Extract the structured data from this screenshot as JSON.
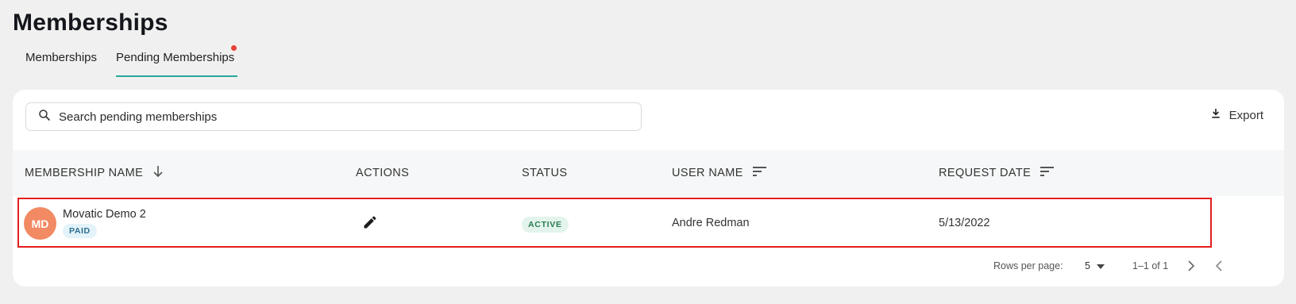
{
  "page": {
    "title": "Memberships"
  },
  "tabs": [
    {
      "label": "Memberships",
      "active": false
    },
    {
      "label": "Pending Memberships",
      "active": true
    }
  ],
  "search": {
    "placeholder": "Search pending memberships",
    "value": ""
  },
  "toolbar": {
    "export_label": "Export"
  },
  "table": {
    "columns": [
      "MEMBERSHIP NAME",
      "ACTIONS",
      "STATUS",
      "USER NAME",
      "REQUEST DATE"
    ],
    "rows": [
      {
        "avatar_initials": "MD",
        "membership_name": "Movatic Demo 2",
        "membership_type": "PAID",
        "status": "ACTIVE",
        "user_name": "Andre Redman",
        "request_date": "5/13/2022"
      }
    ]
  },
  "pagination": {
    "rows_per_page_label": "Rows per page:",
    "rows_per_page_value": "5",
    "range": "1–1 of 1"
  },
  "colors": {
    "accent": "#27a79c",
    "notification_dot": "#e8413a",
    "avatar": "#f28a63",
    "highlight": "#e41e1e"
  },
  "icons": [
    "search-icon",
    "download-icon",
    "arrow-down-icon",
    "sort-icon",
    "pencil-icon",
    "caret-down-icon",
    "chevron-right-icon",
    "chevron-left-icon"
  ]
}
